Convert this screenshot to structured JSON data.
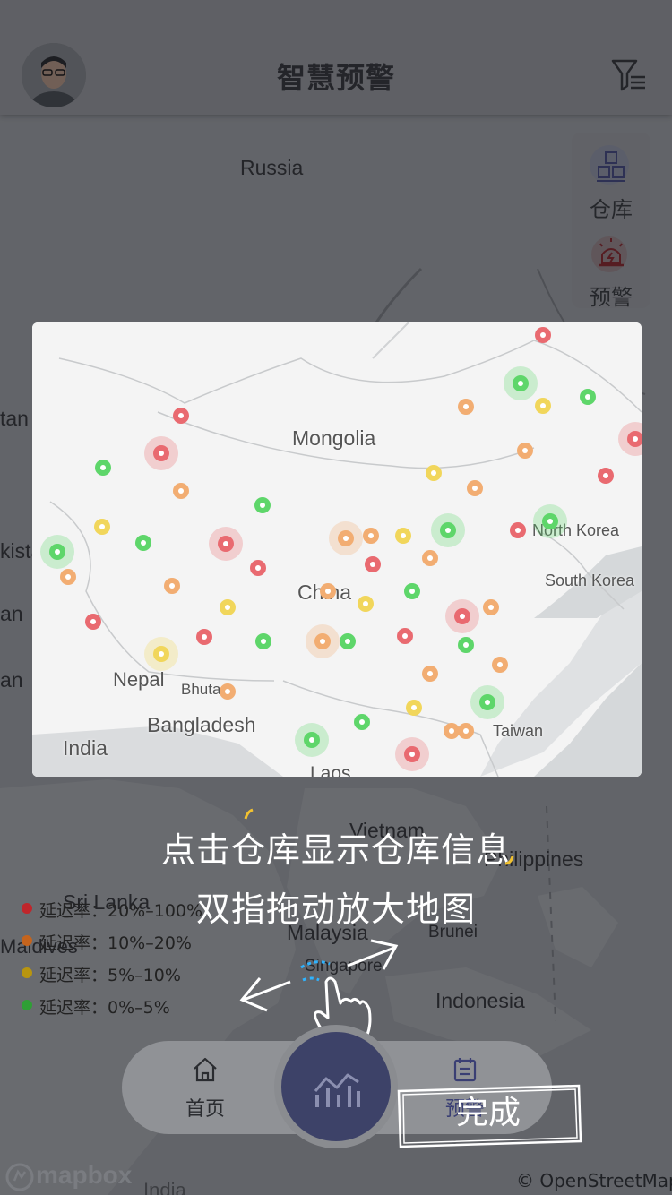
{
  "header": {
    "title": "智慧预警",
    "avatar": "user-avatar",
    "filter_icon": "filter-icon"
  },
  "side_panel": {
    "warehouse_label": "仓库",
    "alert_label": "预警",
    "warehouse_icon": "warehouse-icon",
    "alert_icon": "alarm-light-icon"
  },
  "map": {
    "labels": {
      "russia": "Russia",
      "kazakhstan": "tan",
      "kistan": "kistan",
      "an1": "an",
      "an2": "an",
      "philippines": "Philippines",
      "sri_lanka": "Sri Lanka",
      "maldives": "Maldives",
      "malaysia": "Malaysia",
      "brunei": "Brunei",
      "singapore": "Singapore",
      "indonesia": "Indonesia",
      "vietnam": "Vietnam",
      "india_bottom": "India"
    }
  },
  "preview": {
    "labels": {
      "mongolia": "Mongolia",
      "china": "China",
      "north_korea": "North Korea",
      "south_korea": "South Korea",
      "nepal": "Nepal",
      "bhutan": "Bhutan",
      "bangladesh": "Bangladesh",
      "india": "India",
      "taiwan": "Taiwan",
      "laos": "Laos"
    },
    "colors": {
      "red": "#e96a70",
      "orange": "#f2ad72",
      "yellow": "#f1d65b",
      "green": "#5ed66a"
    }
  },
  "guide": {
    "line1": "点击仓库显示仓库信息",
    "line2": "双指拖动放大地图",
    "hand_icon": "pinch-gesture-icon"
  },
  "legend": {
    "items": [
      {
        "label": "延迟率：20%–100%",
        "color": "#c0262b"
      },
      {
        "label": "延迟率：10%–20%",
        "color": "#c5641d"
      },
      {
        "label": "延迟率：5%–10%",
        "color": "#b8950f"
      },
      {
        "label": "延迟率：0%–5%",
        "color": "#2f9f35"
      }
    ]
  },
  "nav": {
    "home_label": "首页",
    "alert_label": "预警",
    "home_icon": "home-icon",
    "chart_icon": "chart-icon",
    "calendar_icon": "calendar-icon"
  },
  "done_button": "完成",
  "attribution": {
    "mapbox": "mapbox",
    "osm": "© OpenStreetMap"
  }
}
